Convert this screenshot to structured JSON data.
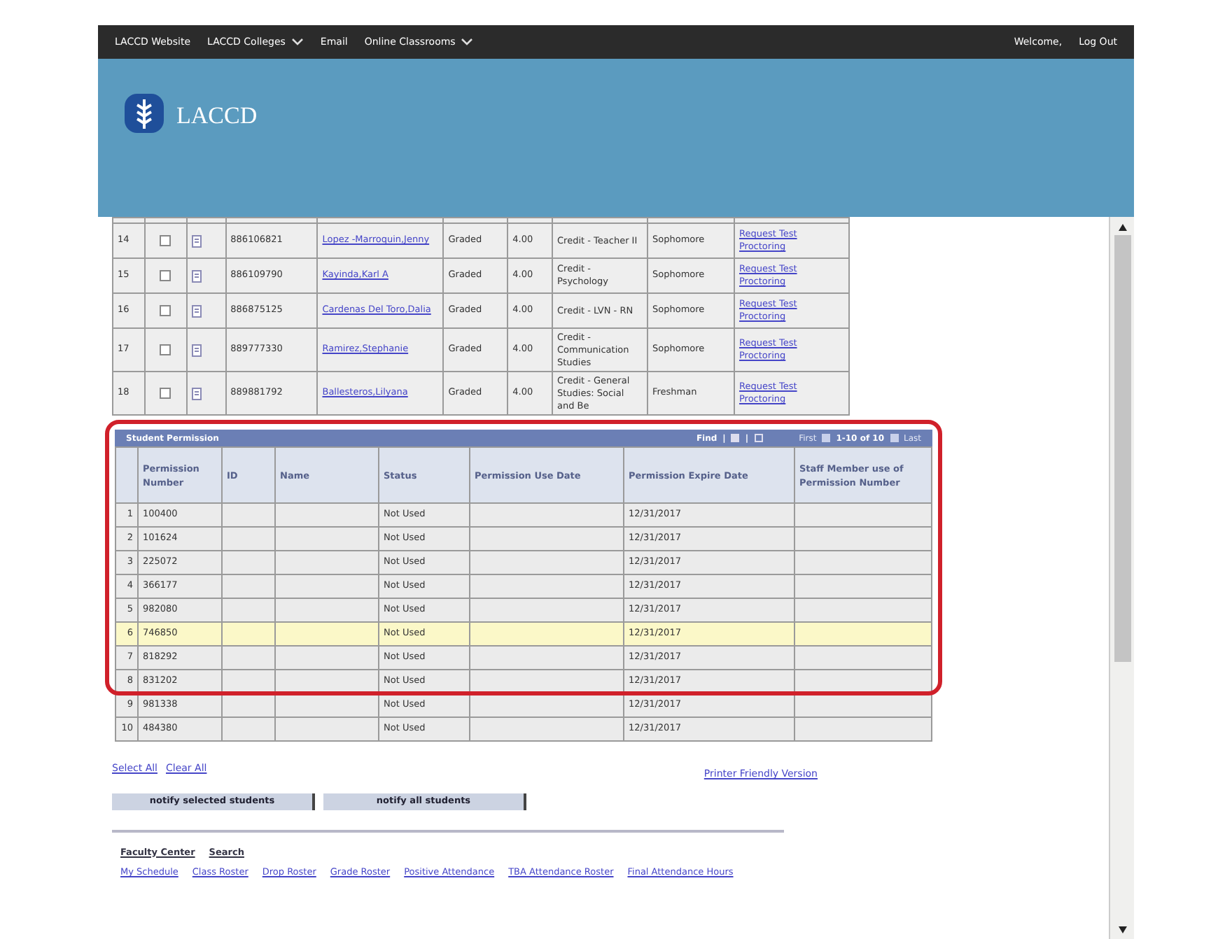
{
  "nav": [
    {
      "label": "LACCD Website",
      "has_menu": false
    },
    {
      "label": "LACCD Colleges",
      "has_menu": true
    },
    {
      "label": "Email",
      "has_menu": false
    },
    {
      "label": "Online Classrooms",
      "has_menu": true
    }
  ],
  "user_links": [
    "Welcome,",
    "Log Out"
  ],
  "logo_text": "LACCD",
  "students": [
    {
      "number": "14",
      "checked": false,
      "id": "886106821",
      "name": "Lopez -Marroquin,Jenny",
      "grading": "Graded",
      "units": "4.00",
      "program": "Credit - Teacher II",
      "level": "Sophomore",
      "action": "Request Test Proctoring"
    },
    {
      "number": "15",
      "checked": false,
      "id": "886109790",
      "name": "Kayinda,Karl A",
      "grading": "Graded",
      "units": "4.00",
      "program": "Credit - Psychology",
      "level": "Sophomore",
      "action": "Request Test Proctoring"
    },
    {
      "number": "16",
      "checked": false,
      "id": "886875125",
      "name": "Cardenas Del Toro,Dalia",
      "grading": "Graded",
      "units": "4.00",
      "program": "Credit - LVN - RN",
      "level": "Sophomore",
      "action": "Request Test Proctoring"
    },
    {
      "number": "17",
      "checked": false,
      "id": "889777330",
      "name": "Ramirez,Stephanie",
      "grading": "Graded",
      "units": "4.00",
      "program": "Credit - Communication Studies",
      "level": "Sophomore",
      "action": "Request Test Proctoring"
    },
    {
      "number": "18",
      "checked": false,
      "id": "889881792",
      "name": "Ballesteros,Lilyana",
      "grading": "Graded",
      "units": "4.00",
      "program": "Credit - General Studies: Social and Be",
      "level": "Freshman",
      "action": "Request Test Proctoring"
    }
  ],
  "permission_grid": {
    "title": "Student Permission",
    "find": "Find",
    "separator": "|",
    "first": "First",
    "range": "1-10 of 10",
    "last": "Last",
    "columns": [
      "Permission Number",
      "ID",
      "Name",
      "Status",
      "Permission Use Date",
      "Permission Expire Date",
      "Staff Member use of Permission Number"
    ],
    "rows": [
      {
        "number": "1",
        "permission_number": "100400",
        "status": "Not Used",
        "expire_date": "12/31/2017",
        "selected": false
      },
      {
        "number": "2",
        "permission_number": "101624",
        "status": "Not Used",
        "expire_date": "12/31/2017",
        "selected": false
      },
      {
        "number": "3",
        "permission_number": "225072",
        "status": "Not Used",
        "expire_date": "12/31/2017",
        "selected": false
      },
      {
        "number": "4",
        "permission_number": "366177",
        "status": "Not Used",
        "expire_date": "12/31/2017",
        "selected": false
      },
      {
        "number": "5",
        "permission_number": "982080",
        "status": "Not Used",
        "expire_date": "12/31/2017",
        "selected": false
      },
      {
        "number": "6",
        "permission_number": "746850",
        "status": "Not Used",
        "expire_date": "12/31/2017",
        "selected": true
      },
      {
        "number": "7",
        "permission_number": "818292",
        "status": "Not Used",
        "expire_date": "12/31/2017",
        "selected": false
      },
      {
        "number": "8",
        "permission_number": "831202",
        "status": "Not Used",
        "expire_date": "12/31/2017",
        "selected": false
      },
      {
        "number": "9",
        "permission_number": "981338",
        "status": "Not Used",
        "expire_date": "12/31/2017",
        "selected": false
      },
      {
        "number": "10",
        "permission_number": "484380",
        "status": "Not Used",
        "expire_date": "12/31/2017",
        "selected": false
      }
    ]
  },
  "select_links": [
    "Select All",
    "Clear All"
  ],
  "printer_link": "Printer Friendly Version",
  "buttons": [
    "notify selected students",
    "notify all students"
  ],
  "footer_heading_links": [
    "Faculty Center",
    "Search"
  ],
  "footer_links": [
    "My Schedule",
    "Class Roster",
    "Drop Roster",
    "Grade Roster",
    "Positive Attendance",
    "TBA Attendance Roster",
    "Final Attendance Hours"
  ]
}
